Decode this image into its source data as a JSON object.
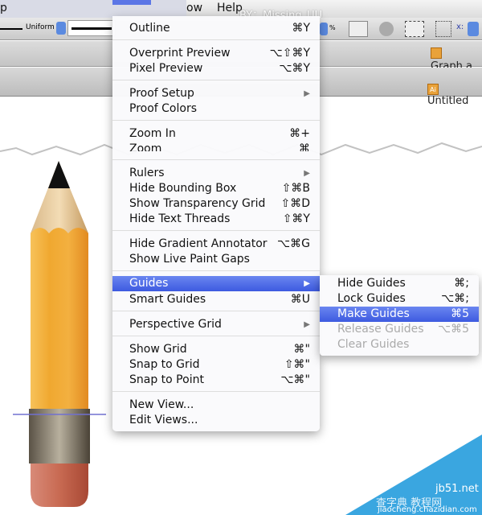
{
  "menubar": {
    "app_fragment": "p",
    "window": "ow",
    "help": "Help",
    "overlay": "BY：Missing_UU"
  },
  "toolbar": {
    "stroke_style": "Uniform",
    "percent": "%",
    "x_label": "x:"
  },
  "docs": {
    "tab1": "Graph.a",
    "tab2": "Untitled",
    "ai_icon": "Ai"
  },
  "view_menu": {
    "items": [
      {
        "label": "Outline",
        "shortcut": "⌘Y"
      },
      {
        "label": "Overprint Preview",
        "shortcut": "⌥⇧⌘Y"
      },
      {
        "label": "Pixel Preview",
        "shortcut": "⌥⌘Y"
      },
      {
        "label": "Proof Setup",
        "submenu": true
      },
      {
        "label": "Proof Colors",
        "shortcut": ""
      },
      {
        "label": "Zoom In",
        "shortcut": "⌘+"
      },
      {
        "label": "Zoom",
        "shortcut": "⌘"
      },
      {
        "label": "Rulers",
        "submenu": true
      },
      {
        "label": "Hide Bounding Box",
        "shortcut": "⇧⌘B"
      },
      {
        "label": "Show Transparency Grid",
        "shortcut": "⇧⌘D"
      },
      {
        "label": "Hide Text Threads",
        "shortcut": "⇧⌘Y"
      },
      {
        "label": "Hide Gradient Annotator",
        "shortcut": "⌥⌘G"
      },
      {
        "label": "Show Live Paint Gaps",
        "shortcut": ""
      },
      {
        "label": "Guides",
        "submenu": true,
        "highlighted": true
      },
      {
        "label": "Smart Guides",
        "shortcut": "⌘U"
      },
      {
        "label": "Perspective Grid",
        "submenu": true
      },
      {
        "label": "Show Grid",
        "shortcut": "⌘\""
      },
      {
        "label": "Snap to Grid",
        "shortcut": "⇧⌘\""
      },
      {
        "label": "Snap to Point",
        "shortcut": "⌥⌘\""
      },
      {
        "label": "New View...",
        "shortcut": ""
      },
      {
        "label": "Edit Views...",
        "shortcut": ""
      }
    ]
  },
  "guides_submenu": {
    "items": [
      {
        "label": "Hide Guides",
        "shortcut": "⌘;",
        "enabled": true
      },
      {
        "label": "Lock Guides",
        "shortcut": "⌥⌘;",
        "enabled": true
      },
      {
        "label": "Make Guides",
        "shortcut": "⌘5",
        "enabled": true,
        "highlighted": true
      },
      {
        "label": "Release Guides",
        "shortcut": "⌥⌘5",
        "enabled": false
      },
      {
        "label": "Clear Guides",
        "shortcut": "",
        "enabled": false
      }
    ]
  },
  "watermark": {
    "site": "jb51.net",
    "cn": "查字典 教程网",
    "url": "jiaocheng.chazidian.com"
  },
  "colors": {
    "highlight": "#4a66e6",
    "pencil_body": "#f0a830",
    "eraser": "#c0604a",
    "watermark": "#3aa6e0"
  }
}
